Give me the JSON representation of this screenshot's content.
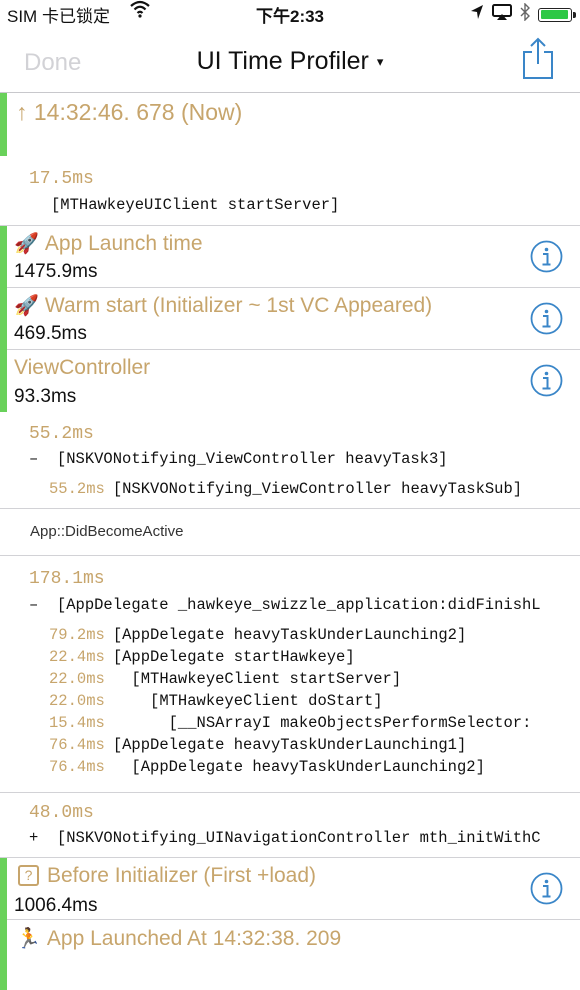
{
  "status_bar": {
    "carrier": "SIM 卡已锁定",
    "time": "下午2:33",
    "icons": [
      "wifi-icon",
      "location-icon",
      "screen-mirror-icon",
      "bluetooth-icon",
      "battery-icon"
    ]
  },
  "nav": {
    "done_label": "Done",
    "title": "UI Time Profiler",
    "title_caret": "▾",
    "share_icon": "share-icon"
  },
  "colors": {
    "accent": "#69d15a",
    "gold": "#c7a56c",
    "info_blue": "#3a86c8"
  },
  "record": {
    "arrow": "↑",
    "time": "14:32:46. 678 (Now)"
  },
  "entries": [
    {
      "ms": "17.5ms",
      "method": "[MTHawkeyeUIClient startServer]"
    }
  ],
  "sections": {
    "app_launch": {
      "icon": "rocket-icon",
      "title": "App Launch time",
      "value": "1475.9ms"
    },
    "warm_start": {
      "icon": "rocket-icon",
      "title": "Warm start (Initializer ~ 1st VC Appeared)",
      "value": "469.5ms"
    },
    "view_controller": {
      "title": "ViewController",
      "value": "93.3ms"
    },
    "before_init": {
      "icon": "question-box-icon",
      "title": "Before Initializer (First +load)",
      "value": "1006.4ms"
    },
    "launched_at": {
      "icon": "runner-icon",
      "title": "App Launched At 14:32:38. 209"
    }
  },
  "vc_trace": {
    "ms": "55.2ms",
    "lines": [
      {
        "prefix": "–",
        "ms": "",
        "method": "[NSKVONotifying_ViewController heavyTask3]"
      },
      {
        "prefix": "",
        "ms": "55.2ms",
        "method": "[NSKVONotifying_ViewController heavyTaskSub]"
      }
    ]
  },
  "did_become_active": "App::DidBecomeActive",
  "launch_trace": {
    "ms": "178.1ms",
    "lines": [
      {
        "prefix": "–",
        "ms": "",
        "method": "[AppDelegate _hawkeye_swizzle_application:didFinishL"
      },
      {
        "prefix": "",
        "ms": "79.2ms",
        "method": "[AppDelegate heavyTaskUnderLaunching2]"
      },
      {
        "prefix": "",
        "ms": "22.4ms",
        "method": "[AppDelegate startHawkeye]"
      },
      {
        "prefix": "",
        "ms": "22.0ms",
        "method": "  [MTHawkeyeClient startServer]"
      },
      {
        "prefix": "",
        "ms": "22.0ms",
        "method": "    [MTHawkeyeClient doStart]"
      },
      {
        "prefix": "",
        "ms": "15.4ms",
        "method": "      [__NSArrayI makeObjectsPerformSelector:"
      },
      {
        "prefix": "",
        "ms": "76.4ms",
        "method": "[AppDelegate heavyTaskUnderLaunching1]"
      },
      {
        "prefix": "",
        "ms": "76.4ms",
        "method": "  [AppDelegate heavyTaskUnderLaunching2]"
      }
    ]
  },
  "nav_trace": {
    "ms": "48.0ms",
    "lines": [
      {
        "prefix": "+",
        "ms": "",
        "method": "[NSKVONotifying_UINavigationController mth_initWithC"
      }
    ]
  }
}
